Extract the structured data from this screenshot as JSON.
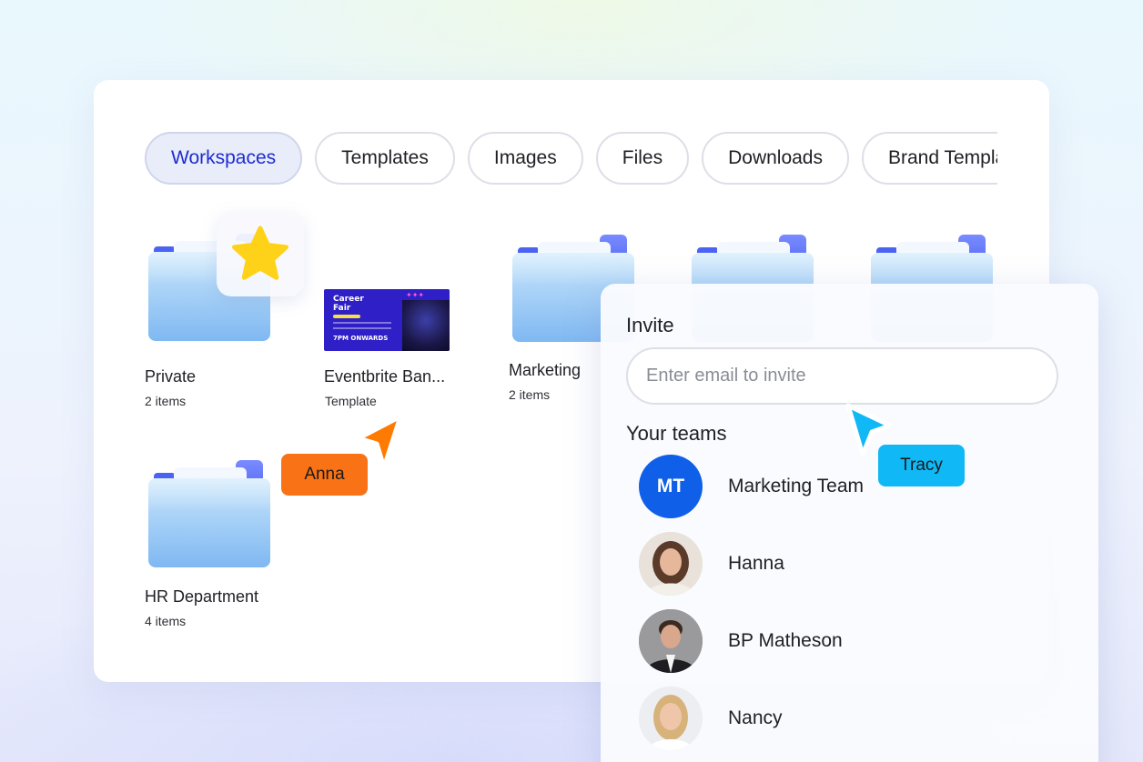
{
  "tabs": [
    {
      "label": "Workspaces",
      "active": true
    },
    {
      "label": "Templates",
      "active": false
    },
    {
      "label": "Images",
      "active": false
    },
    {
      "label": "Files",
      "active": false
    },
    {
      "label": "Downloads",
      "active": false
    },
    {
      "label": "Brand Templates",
      "active": false
    }
  ],
  "items": {
    "private": {
      "name": "Private",
      "meta": "2 items"
    },
    "eventbrite": {
      "name": "Eventbrite Ban...",
      "meta": "Template",
      "thumb_title": "Career Fair",
      "thumb_time": "7PM ONWARDS"
    },
    "marketing": {
      "name": "Marketing",
      "meta": "2 items"
    },
    "hr": {
      "name": "HR Department",
      "meta": "4 items"
    }
  },
  "cursors": {
    "anna": {
      "label": "Anna",
      "color": "#f97316"
    },
    "tracy": {
      "label": "Tracy",
      "color": "#10b8f5"
    }
  },
  "invite": {
    "title": "Invite",
    "placeholder": "Enter email to invite",
    "teams_title": "Your teams",
    "members": [
      {
        "initials": "MT",
        "name": "Marketing Team",
        "avatar": "initials",
        "color": "#0f5fe8"
      },
      {
        "name": "Hanna",
        "avatar": "photo"
      },
      {
        "name": "BP Matheson",
        "avatar": "photo"
      },
      {
        "name": "Nancy",
        "avatar": "photo"
      }
    ]
  },
  "icons": {
    "favorite": "star-icon",
    "folder": "folder-icon"
  }
}
